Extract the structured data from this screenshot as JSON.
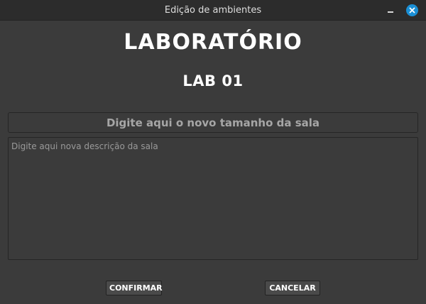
{
  "window": {
    "title": "Edição de ambientes"
  },
  "heading": {
    "category": "LABORATÓRIO",
    "room": "LAB 01"
  },
  "form": {
    "size_placeholder": "Digite aqui o novo tamanho da sala",
    "size_value": "",
    "description_placeholder": "Digite aqui nova descrição da sala",
    "description_value": ""
  },
  "buttons": {
    "confirm_label": "CONFIRMAR",
    "cancel_label": "CANCELAR"
  },
  "icons": {
    "minimize": "minimize-icon",
    "close": "close-icon"
  },
  "colors": {
    "background": "#3b3b3b",
    "titlebar": "#2c2c2c",
    "close_button": "#1a8fd5"
  }
}
